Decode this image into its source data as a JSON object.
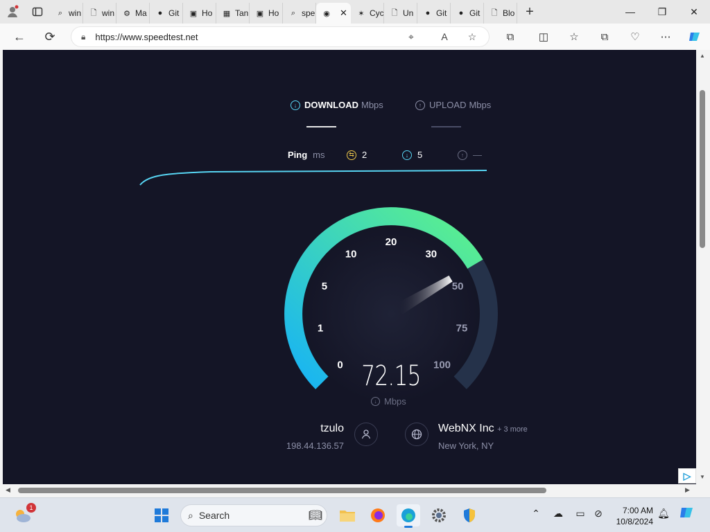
{
  "browser": {
    "tabs": [
      {
        "label": "win",
        "icon": "search-icon"
      },
      {
        "label": "win",
        "icon": "page-icon"
      },
      {
        "label": "Ma",
        "icon": "settings-page-icon"
      },
      {
        "label": "Git",
        "icon": "github-icon"
      },
      {
        "label": "Ho",
        "icon": "app-icon"
      },
      {
        "label": "Tan",
        "icon": "microsoft-icon"
      },
      {
        "label": "Ho",
        "icon": "app-icon"
      },
      {
        "label": "spe",
        "icon": "search-icon"
      },
      {
        "label": "",
        "icon": "speedtest-icon",
        "active": true
      },
      {
        "label": "Cyc",
        "icon": "star-icon"
      },
      {
        "label": "Un",
        "icon": "page-icon"
      },
      {
        "label": "Git",
        "icon": "github-icon"
      },
      {
        "label": "Git",
        "icon": "github-icon"
      },
      {
        "label": "Blo",
        "icon": "page-icon"
      }
    ],
    "url": "https://www.speedtest.net"
  },
  "speedtest": {
    "download_label": "DOWNLOAD",
    "download_unit": "Mbps",
    "upload_label": "UPLOAD",
    "upload_unit": "Mbps",
    "ping_label": "Ping",
    "ping_unit": "ms",
    "ping_idle": "2",
    "ping_download": "5",
    "ping_upload": "—",
    "gauge_ticks": [
      "0",
      "1",
      "5",
      "10",
      "20",
      "30",
      "50",
      "75",
      "100"
    ],
    "speed_value": "72.15",
    "speed_unit": "Mbps",
    "gauge_progress_fraction": 0.72,
    "isp_name": "tzulo",
    "isp_ip": "198.44.136.57",
    "server_name": "WebNX Inc",
    "server_more": "+ 3 more",
    "server_location": "New York, NY"
  },
  "colors": {
    "background": "#141526",
    "gauge_start": "#17b3f5",
    "gauge_end": "#5ef28a",
    "accent_cyan": "#57d4f2"
  },
  "taskbar": {
    "search_placeholder": "Search",
    "weather_badge": "1",
    "time": "7:00 AM",
    "date": "10/8/2024"
  }
}
